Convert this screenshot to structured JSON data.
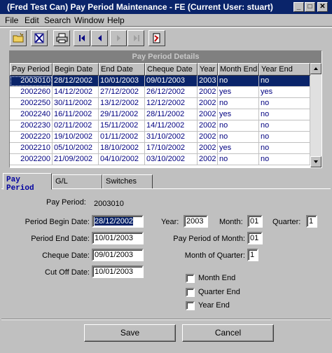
{
  "window": {
    "title": "(Fred Test Can) Pay Period Maintenance - FE (Current User: stuart)",
    "minimize": "_",
    "maximize": "□",
    "close": "✕"
  },
  "menu": [
    "File",
    "Edit",
    "Search",
    "Window",
    "Help"
  ],
  "toolbar": [
    "new-folder-icon",
    "delete-icon",
    "print-icon",
    "first-record-icon",
    "previous-record-icon",
    "next-record-icon",
    "last-record-icon",
    "exit-icon"
  ],
  "grid": {
    "caption": "Pay Period Details",
    "columns": [
      "Pay Period",
      "Begin Date",
      "End Date",
      "Cheque Date",
      "Year",
      "Month End",
      "Year End"
    ],
    "rows": [
      [
        "2003010",
        "28/12/2002",
        "10/01/2003",
        "09/01/2003",
        "2003",
        "no",
        "no"
      ],
      [
        "2002260",
        "14/12/2002",
        "27/12/2002",
        "26/12/2002",
        "2002",
        "yes",
        "yes"
      ],
      [
        "2002250",
        "30/11/2002",
        "13/12/2002",
        "12/12/2002",
        "2002",
        "no",
        "no"
      ],
      [
        "2002240",
        "16/11/2002",
        "29/11/2002",
        "28/11/2002",
        "2002",
        "yes",
        "no"
      ],
      [
        "2002230",
        "02/11/2002",
        "15/11/2002",
        "14/11/2002",
        "2002",
        "no",
        "no"
      ],
      [
        "2002220",
        "19/10/2002",
        "01/11/2002",
        "31/10/2002",
        "2002",
        "no",
        "no"
      ],
      [
        "2002210",
        "05/10/2002",
        "18/10/2002",
        "17/10/2002",
        "2002",
        "yes",
        "no"
      ],
      [
        "2002200",
        "21/09/2002",
        "04/10/2002",
        "03/10/2002",
        "2002",
        "no",
        "no"
      ]
    ],
    "selected_row": 0
  },
  "tabs": [
    "Pay Period",
    "G/L",
    "Switches"
  ],
  "active_tab": 0,
  "form": {
    "pay_period_label": "Pay Period:",
    "pay_period_value": "2003010",
    "begin_date_label": "Period Begin Date:",
    "begin_date_value": "28/12/2002",
    "end_date_label": "Period End Date:",
    "end_date_value": "10/01/2003",
    "cheque_date_label": "Cheque Date:",
    "cheque_date_value": "09/01/2003",
    "cutoff_date_label": "Cut Off Date:",
    "cutoff_date_value": "10/01/2003",
    "year_label": "Year:",
    "year_value": "2003",
    "month_label": "Month:",
    "month_value": "01",
    "quarter_label": "Quarter:",
    "quarter_value": "1",
    "pay_period_of_month_label": "Pay Period of Month:",
    "pay_period_of_month_value": "01",
    "month_of_quarter_label": "Month of Quarter:",
    "month_of_quarter_value": "1",
    "month_end_label": "Month End",
    "quarter_end_label": "Quarter End",
    "year_end_label": "Year End",
    "month_end_checked": false,
    "quarter_end_checked": false,
    "year_end_checked": false
  },
  "buttons": {
    "save": "Save",
    "cancel": "Cancel"
  }
}
